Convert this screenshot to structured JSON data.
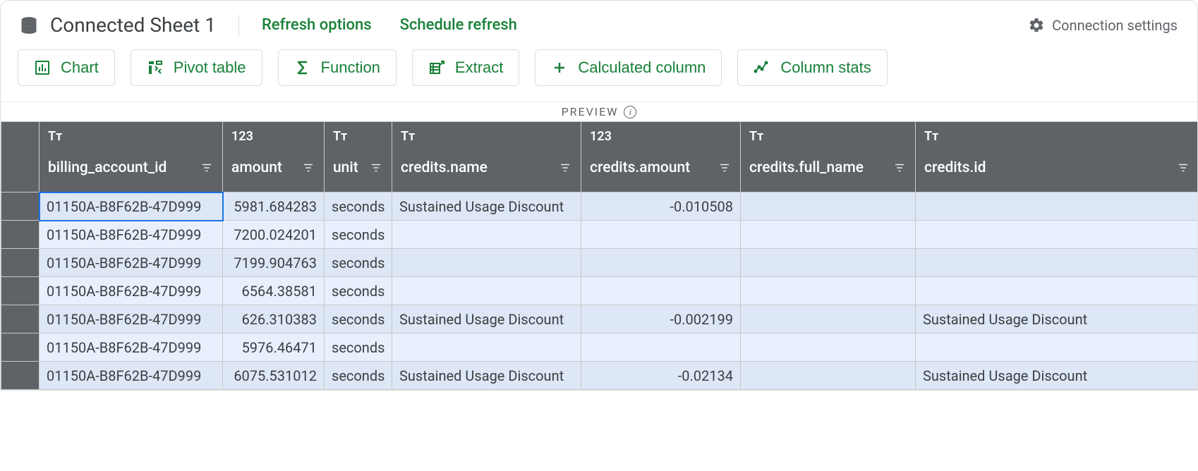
{
  "header": {
    "title": "Connected Sheet 1",
    "refresh_options": "Refresh options",
    "schedule_refresh": "Schedule refresh",
    "connection_settings": "Connection settings"
  },
  "toolbar": {
    "chart": "Chart",
    "pivot_table": "Pivot table",
    "function": "Function",
    "extract": "Extract",
    "calculated_column": "Calculated column",
    "column_stats": "Column stats"
  },
  "preview_label": "PREVIEW",
  "columns": [
    {
      "type_label": "Tт",
      "name": "billing_account_id",
      "kind": "text"
    },
    {
      "type_label": "123",
      "name": "amount",
      "kind": "number"
    },
    {
      "type_label": "Tт",
      "name": "unit",
      "kind": "text"
    },
    {
      "type_label": "Tт",
      "name": "credits.name",
      "kind": "text"
    },
    {
      "type_label": "123",
      "name": "credits.amount",
      "kind": "number"
    },
    {
      "type_label": "Tт",
      "name": "credits.full_name",
      "kind": "text"
    },
    {
      "type_label": "Tт",
      "name": "credits.id",
      "kind": "text"
    }
  ],
  "rows": [
    {
      "billing_account_id": "01150A-B8F62B-47D999",
      "amount": "5981.684283",
      "unit": "seconds",
      "credits_name": "Sustained Usage Discount",
      "credits_amount": "-0.010508",
      "credits_full_name": "",
      "credits_id": ""
    },
    {
      "billing_account_id": "01150A-B8F62B-47D999",
      "amount": "7200.024201",
      "unit": "seconds",
      "credits_name": "",
      "credits_amount": "",
      "credits_full_name": "",
      "credits_id": ""
    },
    {
      "billing_account_id": "01150A-B8F62B-47D999",
      "amount": "7199.904763",
      "unit": "seconds",
      "credits_name": "",
      "credits_amount": "",
      "credits_full_name": "",
      "credits_id": ""
    },
    {
      "billing_account_id": "01150A-B8F62B-47D999",
      "amount": "6564.38581",
      "unit": "seconds",
      "credits_name": "",
      "credits_amount": "",
      "credits_full_name": "",
      "credits_id": ""
    },
    {
      "billing_account_id": "01150A-B8F62B-47D999",
      "amount": "626.310383",
      "unit": "seconds",
      "credits_name": "Sustained Usage Discount",
      "credits_amount": "-0.002199",
      "credits_full_name": "",
      "credits_id": "Sustained Usage Discount"
    },
    {
      "billing_account_id": "01150A-B8F62B-47D999",
      "amount": "5976.46471",
      "unit": "seconds",
      "credits_name": "",
      "credits_amount": "",
      "credits_full_name": "",
      "credits_id": ""
    },
    {
      "billing_account_id": "01150A-B8F62B-47D999",
      "amount": "6075.531012",
      "unit": "seconds",
      "credits_name": "Sustained Usage Discount",
      "credits_amount": "-0.02134",
      "credits_full_name": "",
      "credits_id": "Sustained Usage Discount"
    }
  ],
  "selected_cell": {
    "row": 0,
    "col": 0
  }
}
